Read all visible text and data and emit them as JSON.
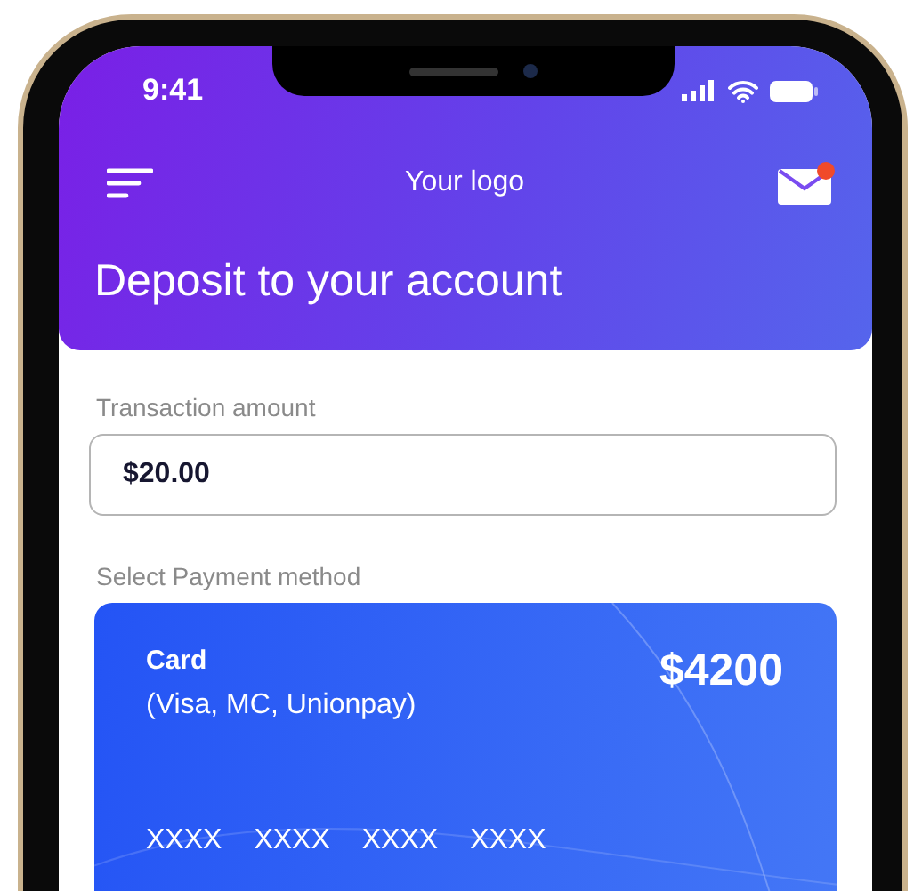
{
  "status_bar": {
    "time": "9:41"
  },
  "header": {
    "logo": "Your logo",
    "mail_unread": true,
    "title": "Deposit to your account"
  },
  "amount": {
    "label": "Transaction amount",
    "value": "$20.00"
  },
  "payment": {
    "label": "Select Payment method",
    "card": {
      "name": "Card",
      "types": "(Visa, MC, Unionpay)",
      "balance": "$4200",
      "number_groups": [
        "XXXX",
        "XXXX",
        "XXXX",
        "XXXX"
      ]
    }
  }
}
